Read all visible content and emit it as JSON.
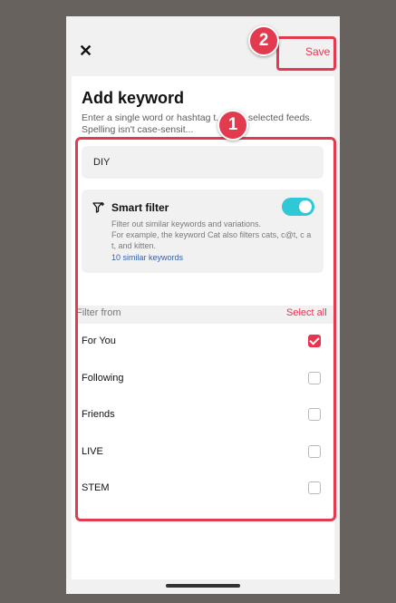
{
  "header": {
    "close_icon": "close-icon",
    "save_label": "Save"
  },
  "page": {
    "title": "Add keyword",
    "description": "Enter a single word or hashtag t... from selected feeds. Spelling isn't case-sensit..."
  },
  "keyword_input": {
    "value": "DIY"
  },
  "smart_filter": {
    "icon": "filter-plus-icon",
    "title": "Smart filter",
    "enabled": true,
    "desc_line1": "Filter out similar keywords and variations.",
    "desc_line2": "For example, the keyword Cat also filters cats, c@t, c a t, and kitten.",
    "link": "10 similar keywords"
  },
  "filter": {
    "label": "Filter from",
    "select_all": "Select all",
    "items": [
      {
        "label": "For You",
        "checked": true
      },
      {
        "label": "Following",
        "checked": false
      },
      {
        "label": "Friends",
        "checked": false
      },
      {
        "label": "LIVE",
        "checked": false
      },
      {
        "label": "STEM",
        "checked": false
      }
    ]
  },
  "annotations": {
    "badge_1": "1",
    "badge_2": "2"
  },
  "colors": {
    "accent": "#e8344e",
    "toggle": "#2ec8d6",
    "highlight_border": "#e23b4f",
    "link": "#3961a8"
  }
}
